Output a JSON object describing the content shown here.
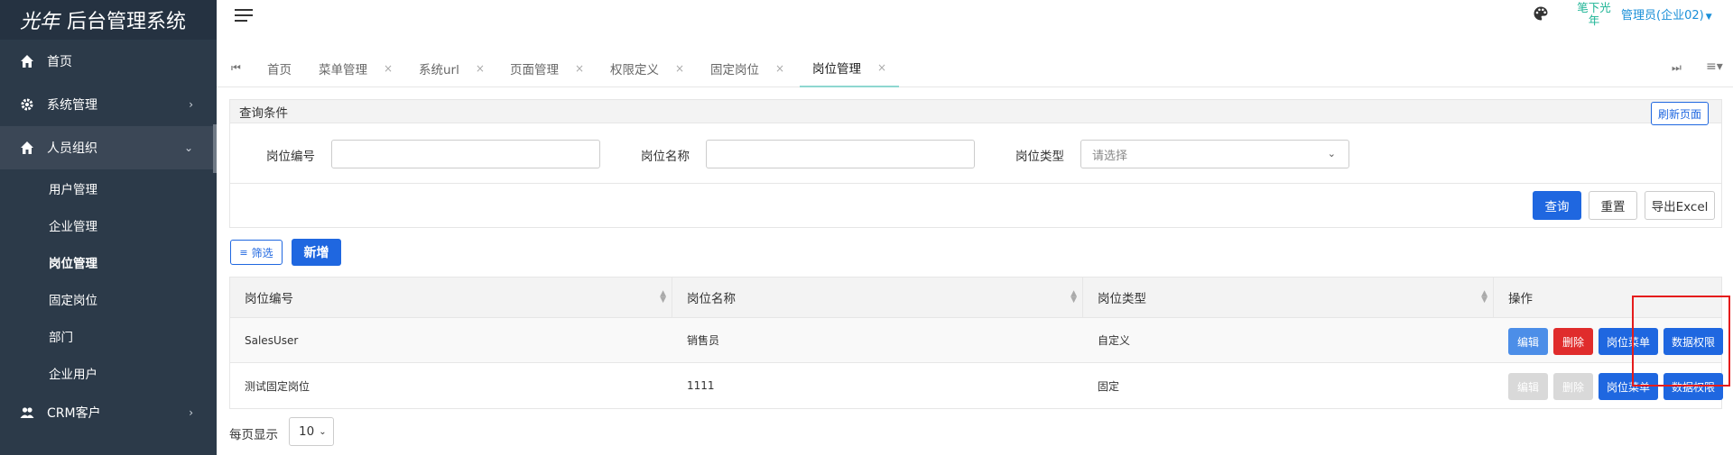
{
  "app": {
    "brand": "光年",
    "title": "后台管理系统"
  },
  "sidebar": {
    "items": [
      {
        "label": "首页",
        "icon": "home-icon"
      },
      {
        "label": "系统管理",
        "icon": "gear-icon"
      },
      {
        "label": "人员组织",
        "icon": "home-icon"
      }
    ],
    "sub_items": [
      "用户管理",
      "企业管理",
      "岗位管理",
      "固定岗位",
      "部门",
      "企业用户"
    ],
    "bottom_item": {
      "label": "CRM客户",
      "icon": "people-icon"
    }
  },
  "header": {
    "avatar_alt": "笔下光年",
    "user": "管理员(企业02)"
  },
  "tabs": {
    "items": [
      {
        "label": "首页"
      },
      {
        "label": "菜单管理",
        "closable": true
      },
      {
        "label": "系统url",
        "closable": true
      },
      {
        "label": "页面管理",
        "closable": true
      },
      {
        "label": "权限定义",
        "closable": true
      },
      {
        "label": "固定岗位",
        "closable": true
      },
      {
        "label": "岗位管理",
        "closable": true,
        "active": true
      }
    ],
    "close_glyph": "×"
  },
  "query": {
    "title": "查询条件",
    "refresh": "刷新页面",
    "fields": [
      {
        "label": "岗位编号",
        "value": ""
      },
      {
        "label": "岗位名称",
        "value": ""
      },
      {
        "label": "岗位类型",
        "placeholder": "请选择"
      }
    ],
    "search": "查询",
    "reset": "重置",
    "export": "导出Excel"
  },
  "toolbar": {
    "filter": "筛选",
    "add": "新增"
  },
  "table": {
    "headers": [
      "岗位编号",
      "岗位名称",
      "岗位类型",
      "操作"
    ],
    "rows": [
      {
        "code": "SalesUser",
        "name": "销售员",
        "type": "自定义",
        "actions": [
          "编辑",
          "删除",
          "岗位菜单",
          "数据权限"
        ],
        "disabled": false
      },
      {
        "code": "测试固定岗位",
        "name": "1111",
        "type": "固定",
        "actions": [
          "编辑",
          "删除",
          "岗位菜单",
          "数据权限"
        ],
        "disabled": true
      }
    ]
  },
  "pager": {
    "label": "每页显示",
    "size": "10"
  },
  "colors": {
    "sidebar": "#2c3a49",
    "primary": "#1f67e0",
    "danger": "#e02c2c",
    "highlight": "#e51c1c",
    "teal": "#1bb394"
  }
}
